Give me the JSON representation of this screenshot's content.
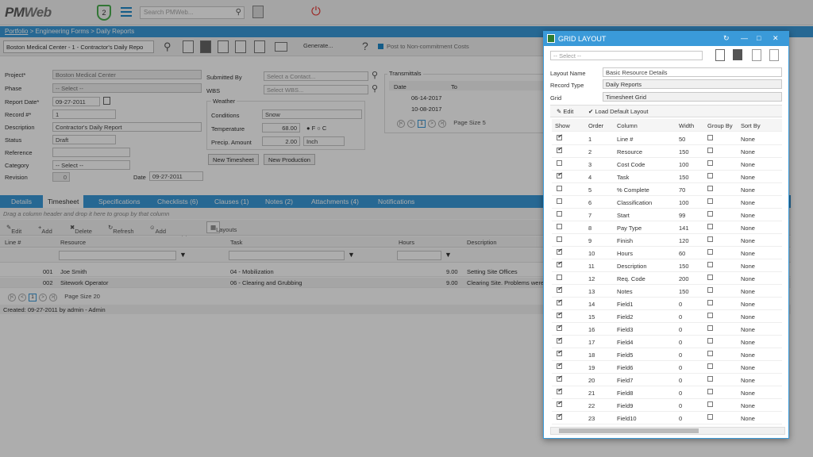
{
  "topbar": {
    "logo": "PMWeb",
    "logo_part1": "PM",
    "logo_part2": "Web",
    "shield_count": "2",
    "search_placeholder": "Search PMWeb..."
  },
  "breadcrumb": {
    "portfolio": "Portfolio",
    "rest": " > Engineering Forms > Daily Reports"
  },
  "toolbar": {
    "project_select": "Boston Medical Center - 1 - Contractor's Daily Repo",
    "generate": "Generate...",
    "post": "Post to Non-commitment Costs"
  },
  "form": {
    "project_label": "Project*",
    "project_value": "Boston Medical Center",
    "phase_label": "Phase",
    "phase_value": "-- Select --",
    "report_date_label": "Report Date*",
    "report_date_value": "09-27-2011",
    "record_label": "Record #*",
    "record_value": "1",
    "description_label": "Description",
    "description_value": "Contractor's Daily Report",
    "status_label": "Status",
    "status_value": "Draft",
    "reference_label": "Reference",
    "reference_value": "",
    "category_label": "Category",
    "category_value": "-- Select --",
    "revision_label": "Revision",
    "revision_value": "0",
    "date_label": "Date",
    "date_value": "09-27-2011",
    "submitted_by_label": "Submitted By",
    "submitted_by_value": "Select a Contact...",
    "wbs_label": "WBS",
    "wbs_value": "Select WBS...",
    "weather_label": "Weather",
    "conditions_label": "Conditions",
    "conditions_value": "Snow",
    "temperature_label": "Temperature",
    "temperature_value": "68.00",
    "temp_f": "F",
    "temp_c": "C",
    "precip_label": "Precip. Amount",
    "precip_value": "2.00",
    "precip_unit": "Inch",
    "new_timesheet": "New Timesheet",
    "new_production": "New Production"
  },
  "transmittals": {
    "title": "Transmittals",
    "col_date": "Date",
    "col_to": "To",
    "rows": [
      "06-14-2017",
      "10-08-2017"
    ],
    "page_size_label": "Page Size",
    "page_size": "5",
    "page": "1"
  },
  "tabs": [
    "Details",
    "Timesheet",
    "Specifications",
    "Checklists (6)",
    "Clauses (1)",
    "Notes (2)",
    "Attachments (4)",
    "Notifications"
  ],
  "group_hint": "Drag a column header and drop it here to group by that column",
  "grid_toolbar": {
    "edit": "Edit",
    "add": "Add",
    "delete": "Delete",
    "refresh": "Refresh",
    "add_resources": "Add Resource(s)",
    "layouts": "Layouts"
  },
  "grid": {
    "headers": [
      "Line #",
      "Resource",
      "Task",
      "Hours",
      "Description"
    ],
    "rows": [
      {
        "line": "001",
        "resource": "Joe Smith",
        "task": "04 - Mobilization",
        "hours": "9.00",
        "desc": "Setting Site Offices"
      },
      {
        "line": "002",
        "resource": "Sitework Operator",
        "task": "06 - Clearing and Grubbing",
        "hours": "9.00",
        "desc": "Clearing Site. Problems were"
      }
    ],
    "page": "1",
    "page_size_label": "Page Size",
    "page_size": "20"
  },
  "footer": {
    "created": "Created:  09-27-2011 by admin - Admin"
  },
  "dialog": {
    "title": "GRID LAYOUT",
    "select_placeholder": "-- Select --",
    "layout_name_label": "Layout Name",
    "layout_name": "Basic Resource Details",
    "record_type_label": "Record Type",
    "record_type": "Daily Reports",
    "grid_label": "Grid",
    "grid_value": "Timesheet Grid",
    "edit": "Edit",
    "load_default": "Load Default Layout",
    "headers": [
      "Show",
      "Order",
      "Column",
      "Width",
      "Group By",
      "Sort By"
    ],
    "rows": [
      {
        "show": true,
        "order": "1",
        "column": "Line #",
        "width": "50",
        "group": false,
        "sort": "None"
      },
      {
        "show": true,
        "order": "2",
        "column": "Resource",
        "width": "150",
        "group": false,
        "sort": "None"
      },
      {
        "show": false,
        "order": "3",
        "column": "Cost Code",
        "width": "100",
        "group": false,
        "sort": "None"
      },
      {
        "show": true,
        "order": "4",
        "column": "Task",
        "width": "150",
        "group": false,
        "sort": "None"
      },
      {
        "show": false,
        "order": "5",
        "column": "% Complete",
        "width": "70",
        "group": false,
        "sort": "None"
      },
      {
        "show": false,
        "order": "6",
        "column": "Classification",
        "width": "100",
        "group": false,
        "sort": "None"
      },
      {
        "show": false,
        "order": "7",
        "column": "Start",
        "width": "99",
        "group": false,
        "sort": "None"
      },
      {
        "show": false,
        "order": "8",
        "column": "Pay Type",
        "width": "141",
        "group": false,
        "sort": "None"
      },
      {
        "show": false,
        "order": "9",
        "column": "Finish",
        "width": "120",
        "group": false,
        "sort": "None"
      },
      {
        "show": true,
        "order": "10",
        "column": "Hours",
        "width": "60",
        "group": false,
        "sort": "None"
      },
      {
        "show": true,
        "order": "11",
        "column": "Description",
        "width": "150",
        "group": false,
        "sort": "None"
      },
      {
        "show": false,
        "order": "12",
        "column": "Req. Code",
        "width": "200",
        "group": false,
        "sort": "None"
      },
      {
        "show": true,
        "order": "13",
        "column": "Notes",
        "width": "150",
        "group": false,
        "sort": "None"
      },
      {
        "show": true,
        "order": "14",
        "column": "Field1",
        "width": "0",
        "group": false,
        "sort": "None"
      },
      {
        "show": true,
        "order": "15",
        "column": "Field2",
        "width": "0",
        "group": false,
        "sort": "None"
      },
      {
        "show": true,
        "order": "16",
        "column": "Field3",
        "width": "0",
        "group": false,
        "sort": "None"
      },
      {
        "show": true,
        "order": "17",
        "column": "Field4",
        "width": "0",
        "group": false,
        "sort": "None"
      },
      {
        "show": true,
        "order": "18",
        "column": "Field5",
        "width": "0",
        "group": false,
        "sort": "None"
      },
      {
        "show": true,
        "order": "19",
        "column": "Field6",
        "width": "0",
        "group": false,
        "sort": "None"
      },
      {
        "show": true,
        "order": "20",
        "column": "Field7",
        "width": "0",
        "group": false,
        "sort": "None"
      },
      {
        "show": true,
        "order": "21",
        "column": "Field8",
        "width": "0",
        "group": false,
        "sort": "None"
      },
      {
        "show": true,
        "order": "22",
        "column": "Field9",
        "width": "0",
        "group": false,
        "sort": "None"
      },
      {
        "show": true,
        "order": "23",
        "column": "Field10",
        "width": "0",
        "group": false,
        "sort": "None"
      }
    ]
  }
}
